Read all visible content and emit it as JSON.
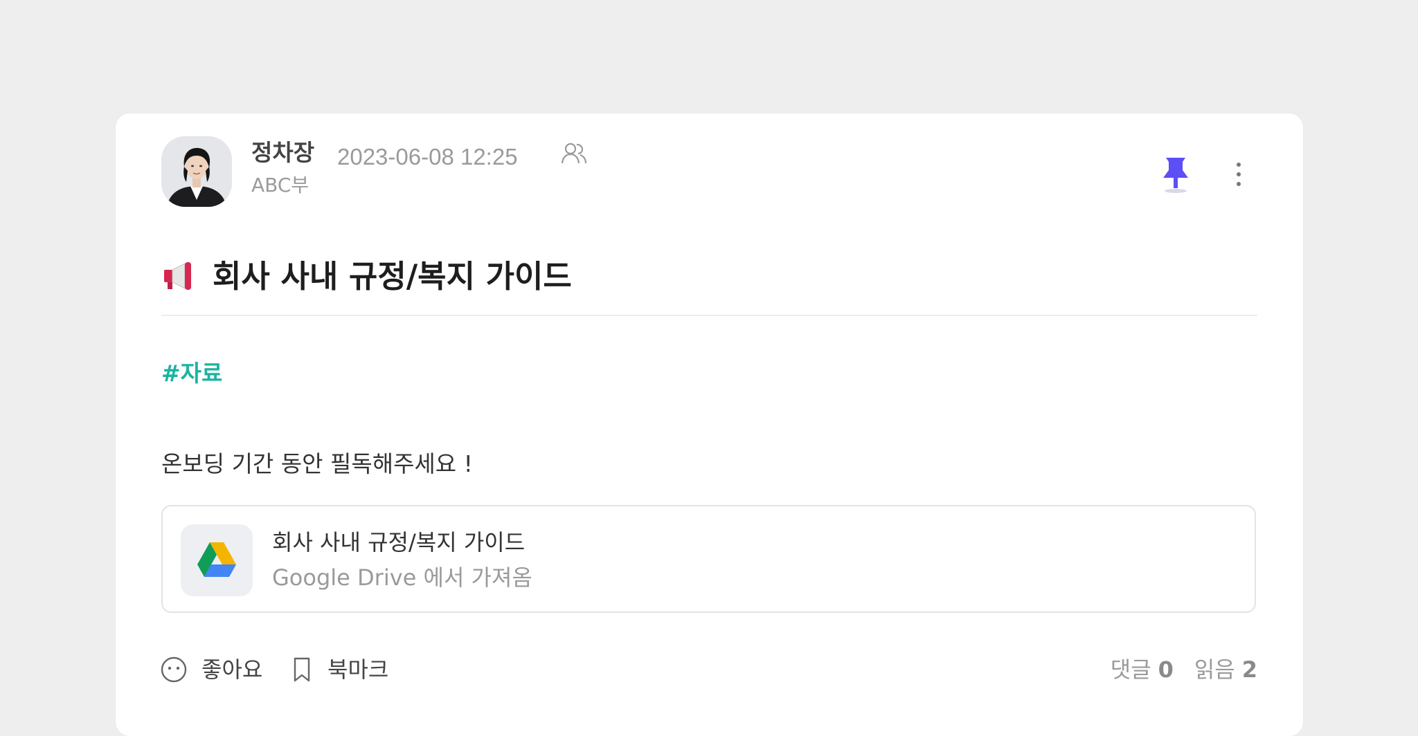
{
  "post": {
    "author_name": "정차장",
    "date": "2023-06-08 12:25",
    "department": "ABC부",
    "title": "회사 사내 규정/복지 가이드",
    "hashtag": "#자료",
    "body": "온보딩 기간 동안 필독해주세요 !",
    "attachment": {
      "title": "회사 사내 규정/복지 가이드",
      "source": "Google Drive 에서 가져옴"
    },
    "actions": {
      "like_label": "좋아요",
      "bookmark_label": "북마크"
    },
    "stats": {
      "comments_label": "댓글",
      "comments_count": "0",
      "reads_label": "읽음",
      "reads_count": "2"
    }
  },
  "icons": {
    "audience": "people-icon",
    "pin": "pin-icon",
    "more": "more-vertical-icon",
    "title_emoji": "megaphone-icon",
    "attachment": "google-drive-icon",
    "like": "smiley-icon",
    "bookmark": "bookmark-icon"
  },
  "colors": {
    "pin": "#5b4ff5",
    "hashtag": "#1bb3a1",
    "background": "#eeeeee"
  }
}
